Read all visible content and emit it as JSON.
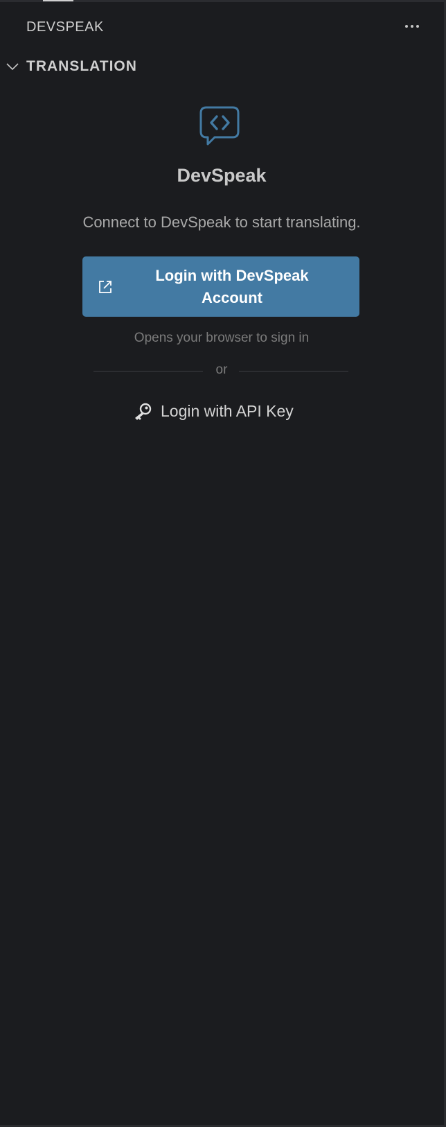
{
  "panel": {
    "title": "DEVSPEAK",
    "more_icon": "ellipsis-icon"
  },
  "section": {
    "title": "TRANSLATION",
    "expanded": true
  },
  "brand": {
    "name": "DevSpeak",
    "logo_icon": "code-chat-bubble-icon",
    "accent_color": "#437aa3"
  },
  "login": {
    "prompt": "Connect to DevSpeak to start translating.",
    "account_button_label": "Login with DevSpeak Account",
    "account_button_icon": "external-link-icon",
    "hint": "Opens your browser to sign in",
    "divider_text": "or",
    "api_key_label": "Login with API Key",
    "api_key_icon": "key-icon"
  }
}
